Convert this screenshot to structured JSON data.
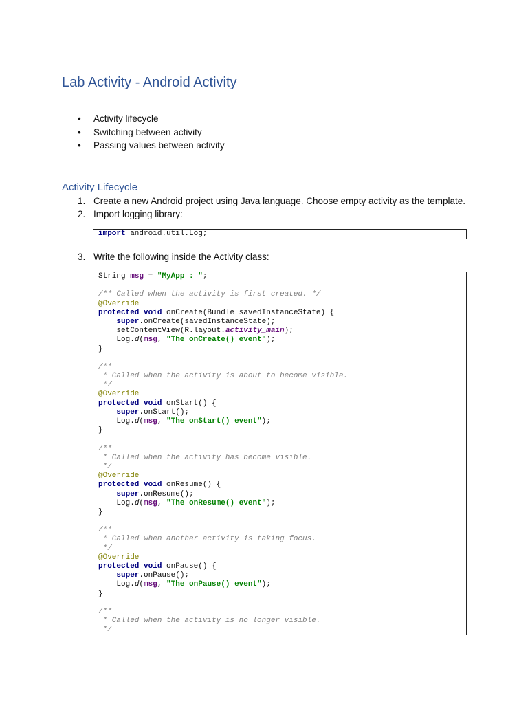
{
  "title": "Lab Activity  - Android Activity",
  "bullets": [
    "Activity lifecycle",
    "Switching between activity",
    "Passing values between activity"
  ],
  "section_heading": "Activity Lifecycle",
  "steps": [
    {
      "num": "1.",
      "text": "Create a new Android project using Java language. Choose empty activity as the template."
    },
    {
      "num": "2.",
      "text": "Import logging library:"
    },
    {
      "num": "3.",
      "text": "Write the following inside the Activity class:"
    }
  ],
  "import_code": [
    [
      [
        "kw",
        "import"
      ],
      [
        "plain",
        " android.util.Log;"
      ]
    ]
  ],
  "code": [
    [
      [
        "plain",
        "String "
      ],
      [
        "field",
        "msg"
      ],
      [
        "plain",
        " = "
      ],
      [
        "str",
        "\"MyApp : \""
      ],
      [
        "plain",
        ";"
      ]
    ],
    [],
    [
      [
        "cm",
        "/** Called when the activity is first created. */"
      ]
    ],
    [
      [
        "ann",
        "@Override"
      ]
    ],
    [
      [
        "kw",
        "protected void"
      ],
      [
        "plain",
        " onCreate(Bundle savedInstanceState) {"
      ]
    ],
    [
      [
        "plain",
        "    "
      ],
      [
        "kw",
        "super"
      ],
      [
        "plain",
        ".onCreate(savedInstanceState);"
      ]
    ],
    [
      [
        "plain",
        "    setContentView(R.layout."
      ],
      [
        "fieldi",
        "activity_main"
      ],
      [
        "plain",
        ");"
      ]
    ],
    [
      [
        "plain",
        "    Log."
      ],
      [
        "stat",
        "d"
      ],
      [
        "plain",
        "("
      ],
      [
        "field",
        "msg"
      ],
      [
        "plain",
        ", "
      ],
      [
        "str",
        "\"The onCreate() event\""
      ],
      [
        "plain",
        ");"
      ]
    ],
    [
      [
        "plain",
        "}"
      ]
    ],
    [],
    [
      [
        "cm",
        "/**"
      ]
    ],
    [
      [
        "cm",
        " * Called when the activity is about to become visible."
      ]
    ],
    [
      [
        "cm",
        " */"
      ]
    ],
    [
      [
        "ann",
        "@Override"
      ]
    ],
    [
      [
        "kw",
        "protected void"
      ],
      [
        "plain",
        " onStart() {"
      ]
    ],
    [
      [
        "plain",
        "    "
      ],
      [
        "kw",
        "super"
      ],
      [
        "plain",
        ".onStart();"
      ]
    ],
    [
      [
        "plain",
        "    Log."
      ],
      [
        "stat",
        "d"
      ],
      [
        "plain",
        "("
      ],
      [
        "field",
        "msg"
      ],
      [
        "plain",
        ", "
      ],
      [
        "str",
        "\"The onStart() event\""
      ],
      [
        "plain",
        ");"
      ]
    ],
    [
      [
        "plain",
        "}"
      ]
    ],
    [],
    [
      [
        "cm",
        "/**"
      ]
    ],
    [
      [
        "cm",
        " * Called when the activity has become visible."
      ]
    ],
    [
      [
        "cm",
        " */"
      ]
    ],
    [
      [
        "ann",
        "@Override"
      ]
    ],
    [
      [
        "kw",
        "protected void"
      ],
      [
        "plain",
        " onResume() {"
      ]
    ],
    [
      [
        "plain",
        "    "
      ],
      [
        "kw",
        "super"
      ],
      [
        "plain",
        ".onResume();"
      ]
    ],
    [
      [
        "plain",
        "    Log."
      ],
      [
        "stat",
        "d"
      ],
      [
        "plain",
        "("
      ],
      [
        "field",
        "msg"
      ],
      [
        "plain",
        ", "
      ],
      [
        "str",
        "\"The onResume() event\""
      ],
      [
        "plain",
        ");"
      ]
    ],
    [
      [
        "plain",
        "}"
      ]
    ],
    [],
    [
      [
        "cm",
        "/**"
      ]
    ],
    [
      [
        "cm",
        " * Called when another activity is taking focus."
      ]
    ],
    [
      [
        "cm",
        " */"
      ]
    ],
    [
      [
        "ann",
        "@Override"
      ]
    ],
    [
      [
        "kw",
        "protected void"
      ],
      [
        "plain",
        " onPause() {"
      ]
    ],
    [
      [
        "plain",
        "    "
      ],
      [
        "kw",
        "super"
      ],
      [
        "plain",
        ".onPause();"
      ]
    ],
    [
      [
        "plain",
        "    Log."
      ],
      [
        "stat",
        "d"
      ],
      [
        "plain",
        "("
      ],
      [
        "field",
        "msg"
      ],
      [
        "plain",
        ", "
      ],
      [
        "str",
        "\"The onPause() event\""
      ],
      [
        "plain",
        ");"
      ]
    ],
    [
      [
        "plain",
        "}"
      ]
    ],
    [],
    [
      [
        "cm",
        "/**"
      ]
    ],
    [
      [
        "cm",
        " * Called when the activity is no longer visible."
      ]
    ],
    [
      [
        "cm",
        " */"
      ]
    ]
  ],
  "colors": {
    "heading": "#2f5496",
    "keyword": "#000080",
    "field": "#660e7a",
    "string": "#008000",
    "comment": "#808080",
    "annotation": "#808000"
  }
}
